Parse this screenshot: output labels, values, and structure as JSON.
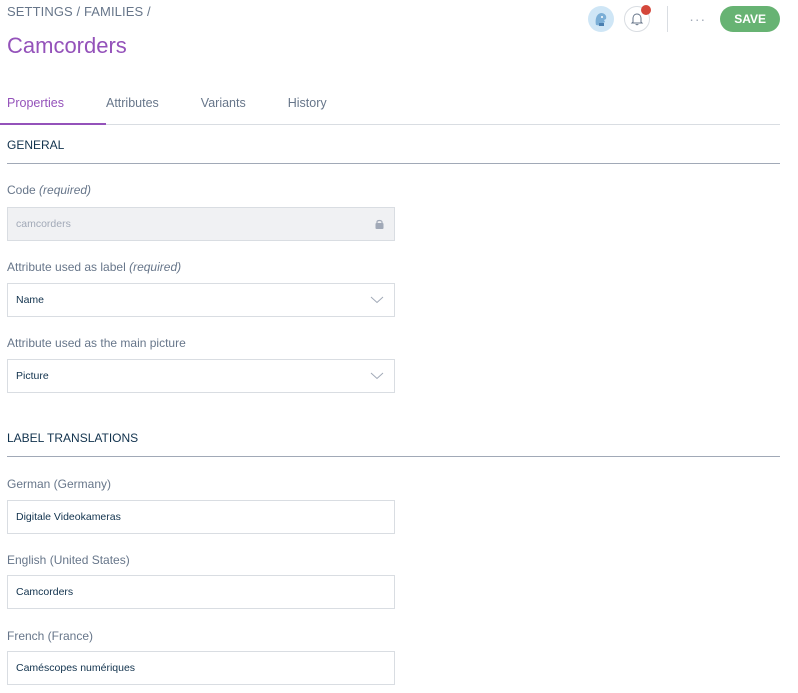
{
  "breadcrumb": "SETTINGS / FAMILIES /",
  "title": "Camcorders",
  "header": {
    "avatar_icon": "user-avatar-icon",
    "notification_icon": "bell-icon",
    "more_label": "···",
    "save_label": "SAVE",
    "colors": {
      "accent": "#9452ba",
      "save": "#67b373",
      "notification_dot": "#d4473b"
    }
  },
  "tabs": [
    {
      "label": "Properties",
      "active": true
    },
    {
      "label": "Attributes",
      "active": false
    },
    {
      "label": "Variants",
      "active": false
    },
    {
      "label": "History",
      "active": false
    }
  ],
  "general": {
    "section_title": "GENERAL",
    "code": {
      "label": "Code",
      "required": "(required)",
      "value": "camcorders",
      "locked": true
    },
    "label_attribute": {
      "label": "Attribute used as label",
      "required": "(required)",
      "value": "Name"
    },
    "picture_attribute": {
      "label": "Attribute used as the main picture",
      "value": "Picture"
    }
  },
  "translations": {
    "section_title": "LABEL TRANSLATIONS",
    "items": [
      {
        "label": "German (Germany)",
        "value": "Digitale Videokameras"
      },
      {
        "label": "English (United States)",
        "value": "Camcorders"
      },
      {
        "label": "French (France)",
        "value": "Caméscopes numériques"
      }
    ]
  }
}
